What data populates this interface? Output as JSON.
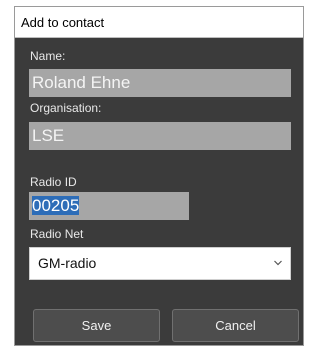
{
  "dialog": {
    "title": "Add to contact",
    "name_label": "Name:",
    "name_value": "Roland Ehne",
    "organisation_label": "Organisation:",
    "organisation_value": "LSE",
    "radio_id_label": "Radio ID",
    "radio_id_value": "00205",
    "radio_net_label": "Radio Net",
    "radio_net_value": "GM-radio",
    "save_label": "Save",
    "cancel_label": "Cancel"
  },
  "colors": {
    "dialog_bg": "#3b3b3b",
    "field_bg": "#a6a6a6",
    "selection": "#2d6db8"
  }
}
